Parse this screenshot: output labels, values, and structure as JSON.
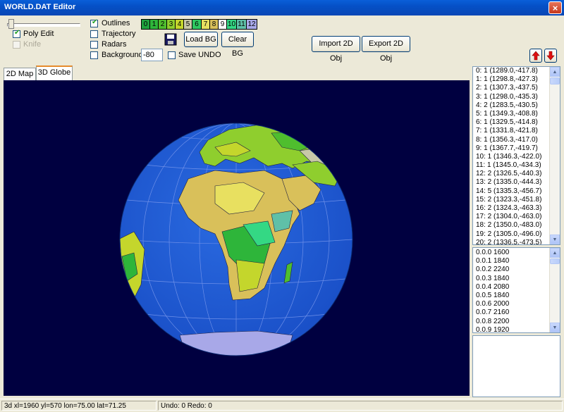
{
  "window": {
    "title": "WORLD.DAT Editor",
    "close_glyph": "×"
  },
  "controls": {
    "poly_edit": {
      "label": "Poly Edit",
      "checked": true
    },
    "knife": {
      "label": "Knife",
      "disabled": true
    },
    "outlines": {
      "label": "Outlines",
      "checked": true
    },
    "trajectory": {
      "label": "Trajectory",
      "checked": false
    },
    "radars": {
      "label": "Radars",
      "checked": false
    },
    "background": {
      "label": "Background",
      "checked": false,
      "value": "-80"
    },
    "save_undo": {
      "label": "Save UNDO",
      "checked": false
    }
  },
  "legend": [
    {
      "label": "0",
      "color": "#1fa23f"
    },
    {
      "label": "1",
      "color": "#2eb53a"
    },
    {
      "label": "2",
      "color": "#4fbe2e"
    },
    {
      "label": "3",
      "color": "#8fce2e"
    },
    {
      "label": "4",
      "color": "#c4d62c"
    },
    {
      "label": "5",
      "color": "#c8c8a8"
    },
    {
      "label": "6",
      "color": "#2fc861"
    },
    {
      "label": "7",
      "color": "#e8e060"
    },
    {
      "label": "8",
      "color": "#d9c05a"
    },
    {
      "label": "9",
      "color": "#ffffff"
    },
    {
      "label": "10",
      "color": "#34d884"
    },
    {
      "label": "11",
      "color": "#5fc0a8"
    },
    {
      "label": "12",
      "color": "#a8a8e8"
    }
  ],
  "buttons": {
    "save_icon": "floppy-disk-icon",
    "load_bg": "Load BG",
    "clear_bg": "Clear BG",
    "import_2d": "Import 2D Obj",
    "export_2d": "Export 2D Obj",
    "up_icon": "red-up-arrow-icon",
    "down_icon": "red-down-arrow-icon"
  },
  "tabs": [
    {
      "label": "2D Map",
      "active": false
    },
    {
      "label": "3D Globe",
      "active": true
    }
  ],
  "poly_list": [
    "0: 1 (1289.0,-417.8)",
    "1: 1 (1298.8,-427.3)",
    "2: 1 (1307.3,-437.5)",
    "3: 1 (1298.0,-435.3)",
    "4: 2 (1283.5,-430.5)",
    "5: 1 (1349.3,-408.8)",
    "6: 1 (1329.5,-414.8)",
    "7: 1 (1331.8,-421.8)",
    "8: 1 (1356.3,-417.0)",
    "9: 1 (1367.7,-419.7)",
    "10: 1 (1346.3,-422.0)",
    "11: 1 (1345.0,-434.3)",
    "12: 2 (1326.5,-440.3)",
    "13: 2 (1335.0,-444.3)",
    "14: 5 (1335.3,-456.7)",
    "15: 2 (1323.3,-451.8)",
    "16: 2 (1324.3,-463.3)",
    "17: 2 (1304.0,-463.0)",
    "18: 2 (1350.0,-483.0)",
    "19: 2 (1305.0,-496.0)",
    "20: 2 (1336.5,-473.5)"
  ],
  "vertex_list": [
    "0.0.0 1600",
    "0.0.1 1840",
    "0.0.2 2240",
    "0.0.3 1840",
    "0.0.4 2080",
    "0.0.5 1840",
    "0.0.6 2000",
    "0.0.7 2160",
    "0.0.8 2200",
    "0.0.9 1920"
  ],
  "status": {
    "coords": "3d xl=1960 yl=570 lon=75.00 lat=71.25",
    "undo": "Undo: 0 Redo: 0"
  }
}
